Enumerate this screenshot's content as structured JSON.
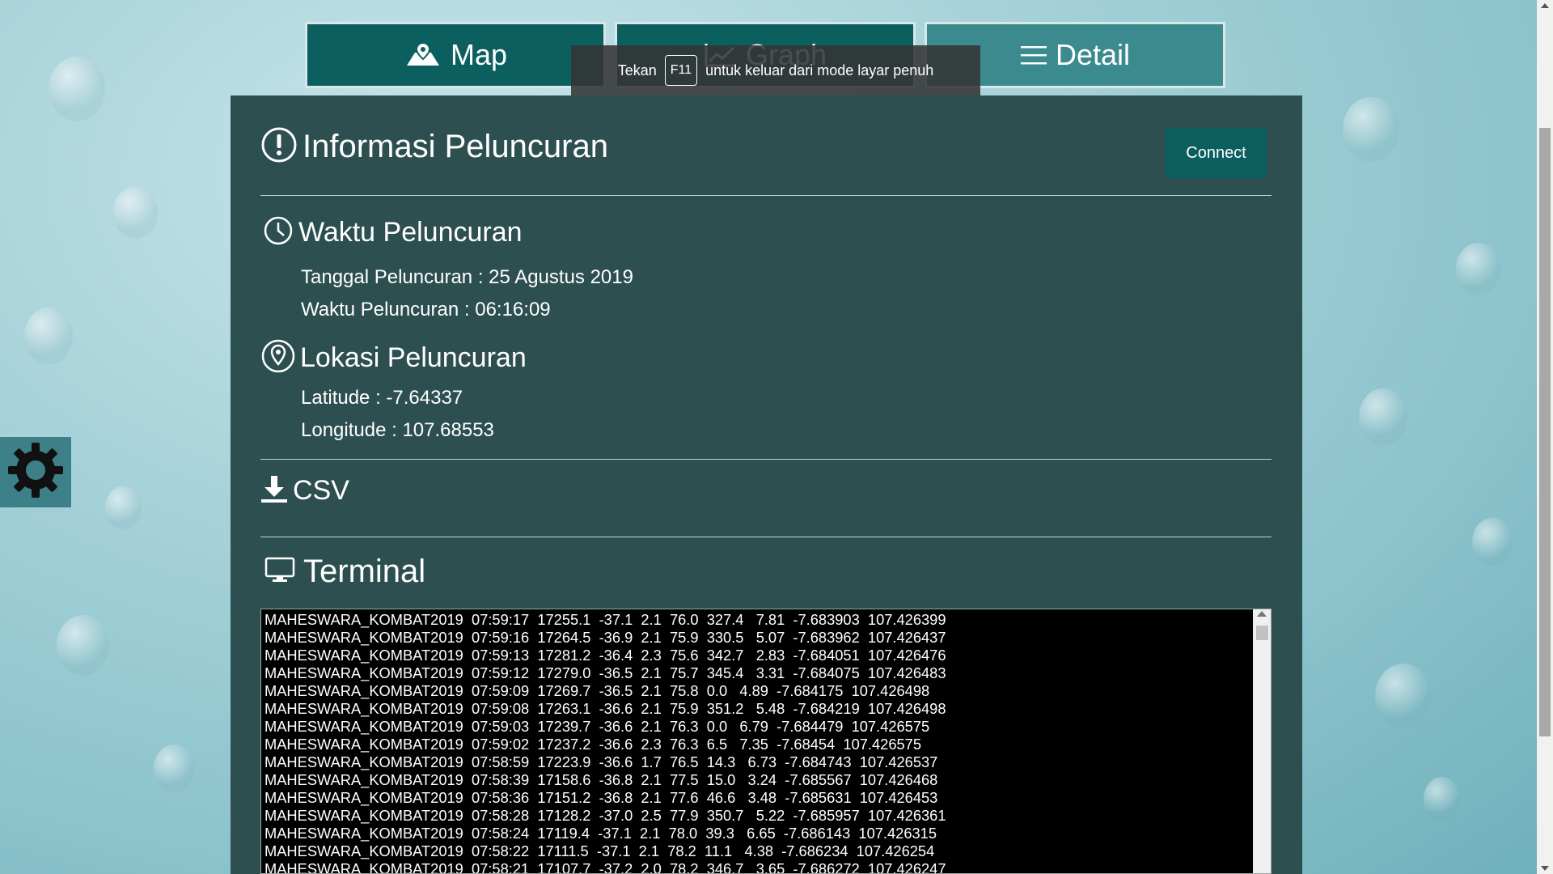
{
  "nav": {
    "tabs": [
      {
        "label": "Map",
        "icon": "map-icon"
      },
      {
        "label": "Graph",
        "icon": "graph-icon"
      },
      {
        "label": "Detail",
        "icon": "menu-icon"
      }
    ]
  },
  "toast": {
    "prefix": "Tekan",
    "key": "F11",
    "suffix": "untuk keluar dari mode layar penuh"
  },
  "panel": {
    "title": "Informasi Peluncuran",
    "title_icon": "exclamation-circle-icon",
    "connect_label": "Connect",
    "time_section": {
      "title": "Waktu Peluncuran",
      "icon": "clock-icon",
      "date_line": "Tanggal Peluncuran : 25 Agustus 2019",
      "time_line": "Waktu Peluncuran : 06:16:09"
    },
    "location_section": {
      "title": "Lokasi Peluncuran",
      "icon": "location-pin-icon",
      "latitude_line": "Latitude : -7.64337",
      "longitude_line": "Longitude : 107.68553"
    },
    "csv": {
      "label": "CSV",
      "icon": "download-icon"
    },
    "terminal": {
      "title": "Terminal",
      "icon": "monitor-icon",
      "lines": [
        "MAHESWARA_KOMBAT2019  07:59:17  17255.1  -37.1  2.1  76.0  327.4   7.81  -7.683903  107.426399",
        "MAHESWARA_KOMBAT2019  07:59:16  17264.5  -36.9  2.1  75.9  330.5   5.07  -7.683962  107.426437",
        "MAHESWARA_KOMBAT2019  07:59:13  17281.2  -36.4  2.3  75.6  342.7   2.83  -7.684051  107.426476",
        "MAHESWARA_KOMBAT2019  07:59:12  17279.0  -36.5  2.1  75.7  345.4   3.31  -7.684075  107.426483",
        "MAHESWARA_KOMBAT2019  07:59:09  17269.7  -36.5  2.1  75.8  0.0   4.89  -7.684175  107.426498",
        "MAHESWARA_KOMBAT2019  07:59:08  17263.1  -36.6  2.1  75.9  351.2   5.48  -7.684219  107.426498",
        "MAHESWARA_KOMBAT2019  07:59:03  17239.7  -36.6  2.1  76.3  0.0   6.79  -7.684479  107.426575",
        "MAHESWARA_KOMBAT2019  07:59:02  17237.2  -36.6  2.3  76.3  6.5   7.35  -7.68454  107.426575",
        "MAHESWARA_KOMBAT2019  07:58:59  17223.9  -36.6  1.7  76.5  14.3   6.73  -7.684743  107.426537",
        "MAHESWARA_KOMBAT2019  07:58:39  17158.6  -36.8  2.1  77.5  15.0   3.24  -7.685567  107.426468",
        "MAHESWARA_KOMBAT2019  07:58:36  17151.2  -36.8  2.1  77.6  46.6   3.48  -7.685631  107.426453",
        "MAHESWARA_KOMBAT2019  07:58:28  17128.2  -37.0  2.5  77.9  350.7   5.22  -7.685957  107.426361",
        "MAHESWARA_KOMBAT2019  07:58:24  17119.4  -37.1  2.1  78.0  39.3   6.65  -7.686143  107.426315",
        "MAHESWARA_KOMBAT2019  07:58:22  17111.5  -37.1  2.1  78.2  11.1   4.38  -7.686234  107.426254",
        "MAHESWARA_KOMBAT2019  07:58:21  17107.7  -37.2  2.0  78.2  346.7   3.65  -7.686272  107.426247"
      ]
    }
  },
  "settings": {
    "icon": "gear-icon"
  },
  "colors": {
    "panel_bg": "#2d4f4f",
    "tab_dark": "#0c5f5f",
    "tab_light": "#3b8a8e",
    "button_bg": "#0c5f5f"
  }
}
